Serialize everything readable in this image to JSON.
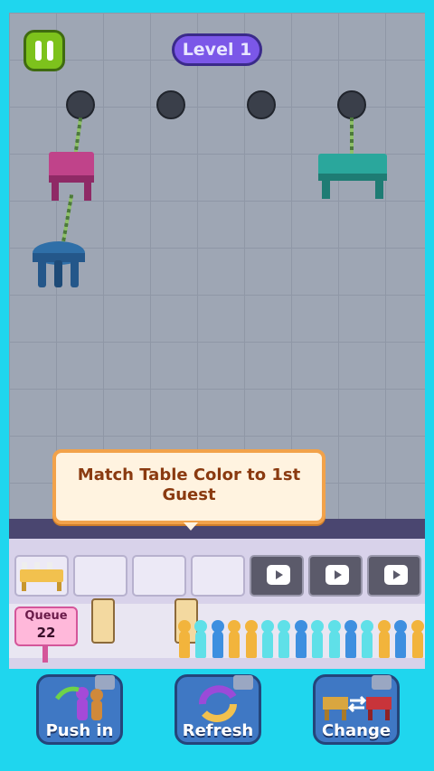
{
  "hud": {
    "level_label": "Level 1",
    "pause_icon": "pause-icon"
  },
  "tutorial": {
    "message": "Match Table Color to 1st Guest"
  },
  "queue": {
    "label": "Queue",
    "count": "22"
  },
  "actions": [
    {
      "label": "Push in",
      "icon": "push-in-icon"
    },
    {
      "label": "Refresh",
      "icon": "refresh-icon"
    },
    {
      "label": "Change",
      "icon": "change-icon"
    }
  ],
  "colors": {
    "pink_table": "#c0438a",
    "teal_table": "#2aa79c",
    "blue_stool": "#2f6fa8",
    "guest_orange": "#f2b43c",
    "guest_cyan": "#5fe0e8",
    "guest_blue": "#3d8fe0"
  },
  "guests": [
    "orange",
    "cyan",
    "blue",
    "orange",
    "orange",
    "cyan",
    "cyan",
    "blue",
    "cyan",
    "cyan",
    "blue",
    "cyan",
    "orange",
    "blue",
    "orange"
  ]
}
